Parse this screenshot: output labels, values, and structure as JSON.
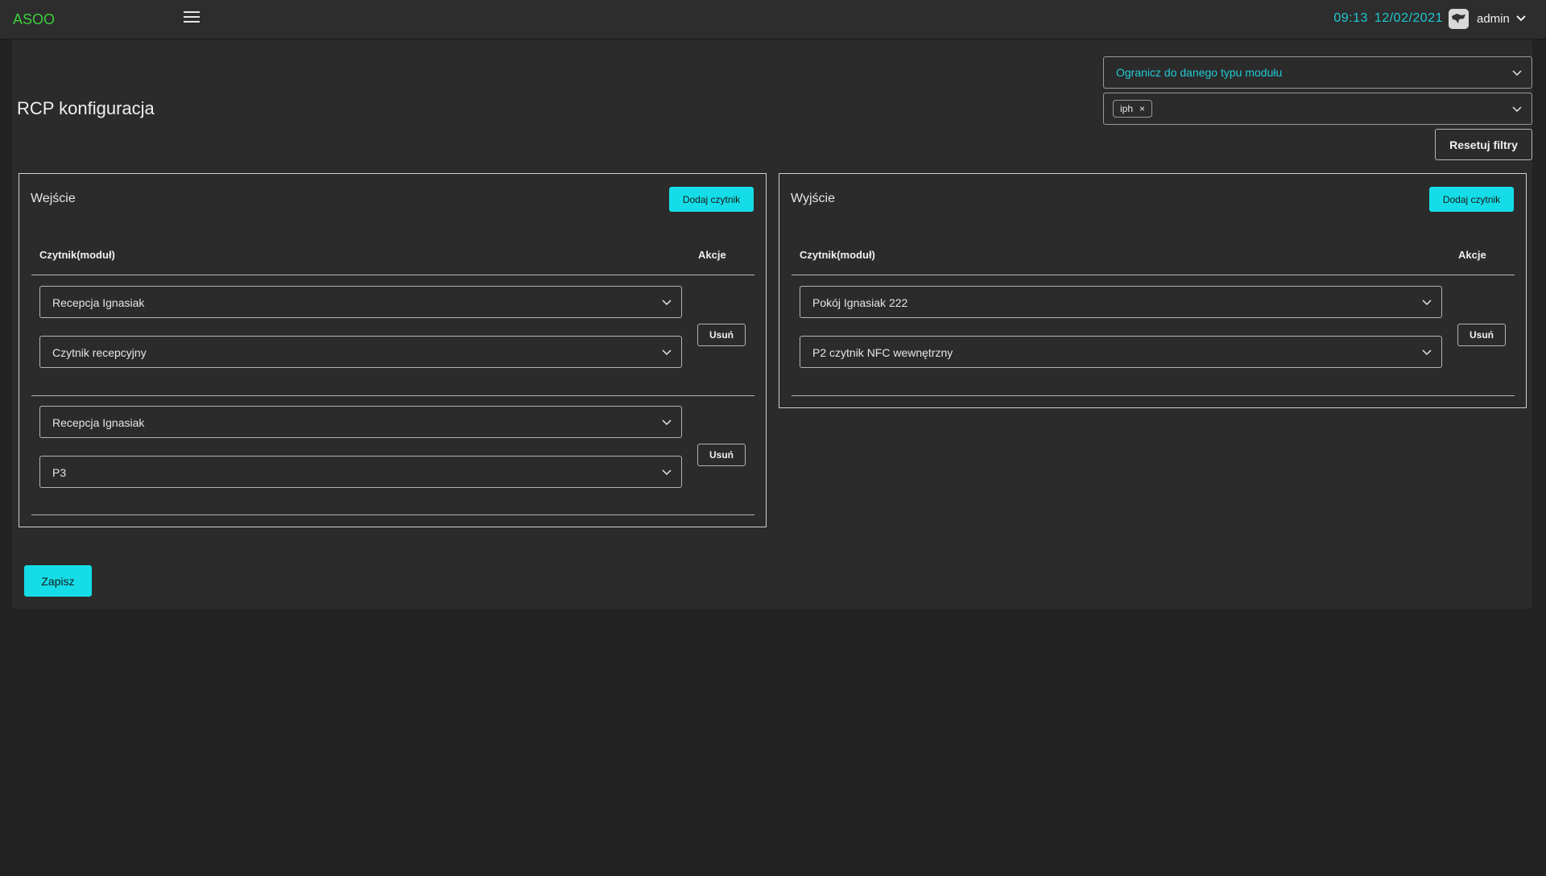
{
  "app": {
    "brand": "ASOO"
  },
  "header": {
    "time": "09:13",
    "date": "12/02/2021",
    "user": "admin"
  },
  "page": {
    "title": "RCP konfiguracja"
  },
  "filters": {
    "module_type_placeholder": "Ogranicz do danego typu modułu",
    "chip": "iph",
    "reset_label": "Resetuj filtry"
  },
  "entry": {
    "title": "Wejście",
    "add_label": "Dodaj czytnik",
    "col_reader": "Czytnik(moduł)",
    "col_actions": "Akcje",
    "rows": [
      {
        "zone": "Recepcja Ignasiak",
        "reader": "Czytnik recepcyjny",
        "remove_label": "Usuń"
      },
      {
        "zone": "Recepcja Ignasiak",
        "reader": "P3",
        "remove_label": "Usuń"
      }
    ]
  },
  "exit": {
    "title": "Wyjście",
    "add_label": "Dodaj czytnik",
    "col_reader": "Czytnik(moduł)",
    "col_actions": "Akcje",
    "rows": [
      {
        "zone": "Pokój Ignasiak 222",
        "reader": "P2 czytnik NFC wewnętrzny",
        "remove_label": "Usuń"
      }
    ]
  },
  "footer": {
    "save_label": "Zapisz"
  },
  "colors": {
    "accent": "#14dde8",
    "brand": "#3bd13b",
    "background": "#222222",
    "panel": "#2b2b2b"
  }
}
